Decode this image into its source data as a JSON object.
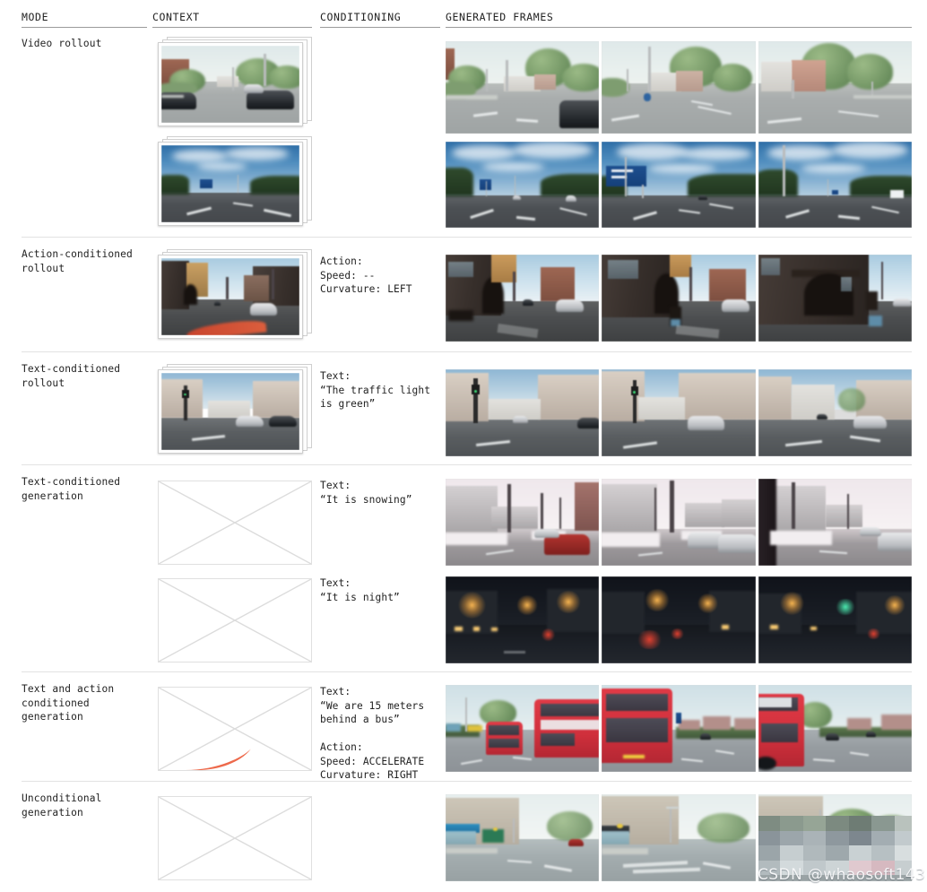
{
  "table": {
    "columns": [
      {
        "key": "mode",
        "label": "MODE"
      },
      {
        "key": "context",
        "label": "CONTEXT"
      },
      {
        "key": "conditioning",
        "label": "CONDITIONING"
      },
      {
        "key": "generated_frames",
        "label": "GENERATED FRAMES"
      }
    ]
  },
  "rows": [
    {
      "mode": "Video rollout",
      "context_type": "frame-stack",
      "conditioning": "",
      "subrows": 2,
      "frames_per_subrow": 3,
      "scene_1": "suburban-green-street",
      "scene_2": "motorway-blue-sky"
    },
    {
      "mode": "Action-conditioned\nrollout",
      "context_type": "frame-stack-with-trajectory",
      "conditioning": "Action:\nSpeed: --\nCurvature: LEFT",
      "conditioning_fields": {
        "action_header": "Action:",
        "speed_label": "Speed:",
        "speed_value": "--",
        "curvature_label": "Curvature:",
        "curvature_value": "LEFT"
      },
      "frames_per_subrow": 3,
      "scene_1": "dark-brick-urban-street"
    },
    {
      "mode": "Text-conditioned\nrollout",
      "context_type": "frame-stack",
      "conditioning": "Text:\n“The traffic light\nis green”",
      "conditioning_fields": {
        "text_header": "Text:",
        "text_value": "“The traffic light is green”"
      },
      "frames_per_subrow": 3,
      "scene_1": "terrace-street-traffic-light"
    },
    {
      "mode": "Text-conditioned\ngeneration",
      "context_type": "empty-placeholder",
      "subrows": 2,
      "conditioning_a": "Text:\n“It is snowing”",
      "conditioning_b": "Text:\n“It is night”",
      "conditioning_fields_a": {
        "text_header": "Text:",
        "text_value": "“It is snowing”"
      },
      "conditioning_fields_b": {
        "text_header": "Text:",
        "text_value": "“It is night”"
      },
      "frames_per_subrow": 3,
      "scene_1": "snowy-residential-street",
      "scene_2": "night-street-with-streetlights"
    },
    {
      "mode": "Text and action\nconditioned\ngeneration",
      "context_type": "empty-placeholder-with-trajectory",
      "conditioning": "Text:\n“We are 15 meters\nbehind a bus”\n\nAction:\nSpeed: ACCELERATE\nCurvature: RIGHT",
      "conditioning_fields": {
        "text_header": "Text:",
        "text_value": "“We are 15 meters behind a bus”",
        "action_header": "Action:",
        "speed_label": "Speed:",
        "speed_value": "ACCELERATE",
        "curvature_label": "Curvature:",
        "curvature_value": "RIGHT"
      },
      "frames_per_subrow": 3,
      "scene_1": "red-double-decker-buses"
    },
    {
      "mode": "Unconditional\ngeneration",
      "context_type": "empty-placeholder",
      "conditioning": "",
      "frames_per_subrow": 3,
      "scene_1": "high-street-shopfronts"
    }
  ],
  "watermark": {
    "text": "CSDN @whaosoft143"
  },
  "colors": {
    "rule": "#9a9a9a",
    "row_separator": "#e2e2e2",
    "text": "#222222",
    "placeholder_border": "#e0e0e0",
    "trajectory": "#d4452c",
    "bus_red": "#d0303c"
  }
}
